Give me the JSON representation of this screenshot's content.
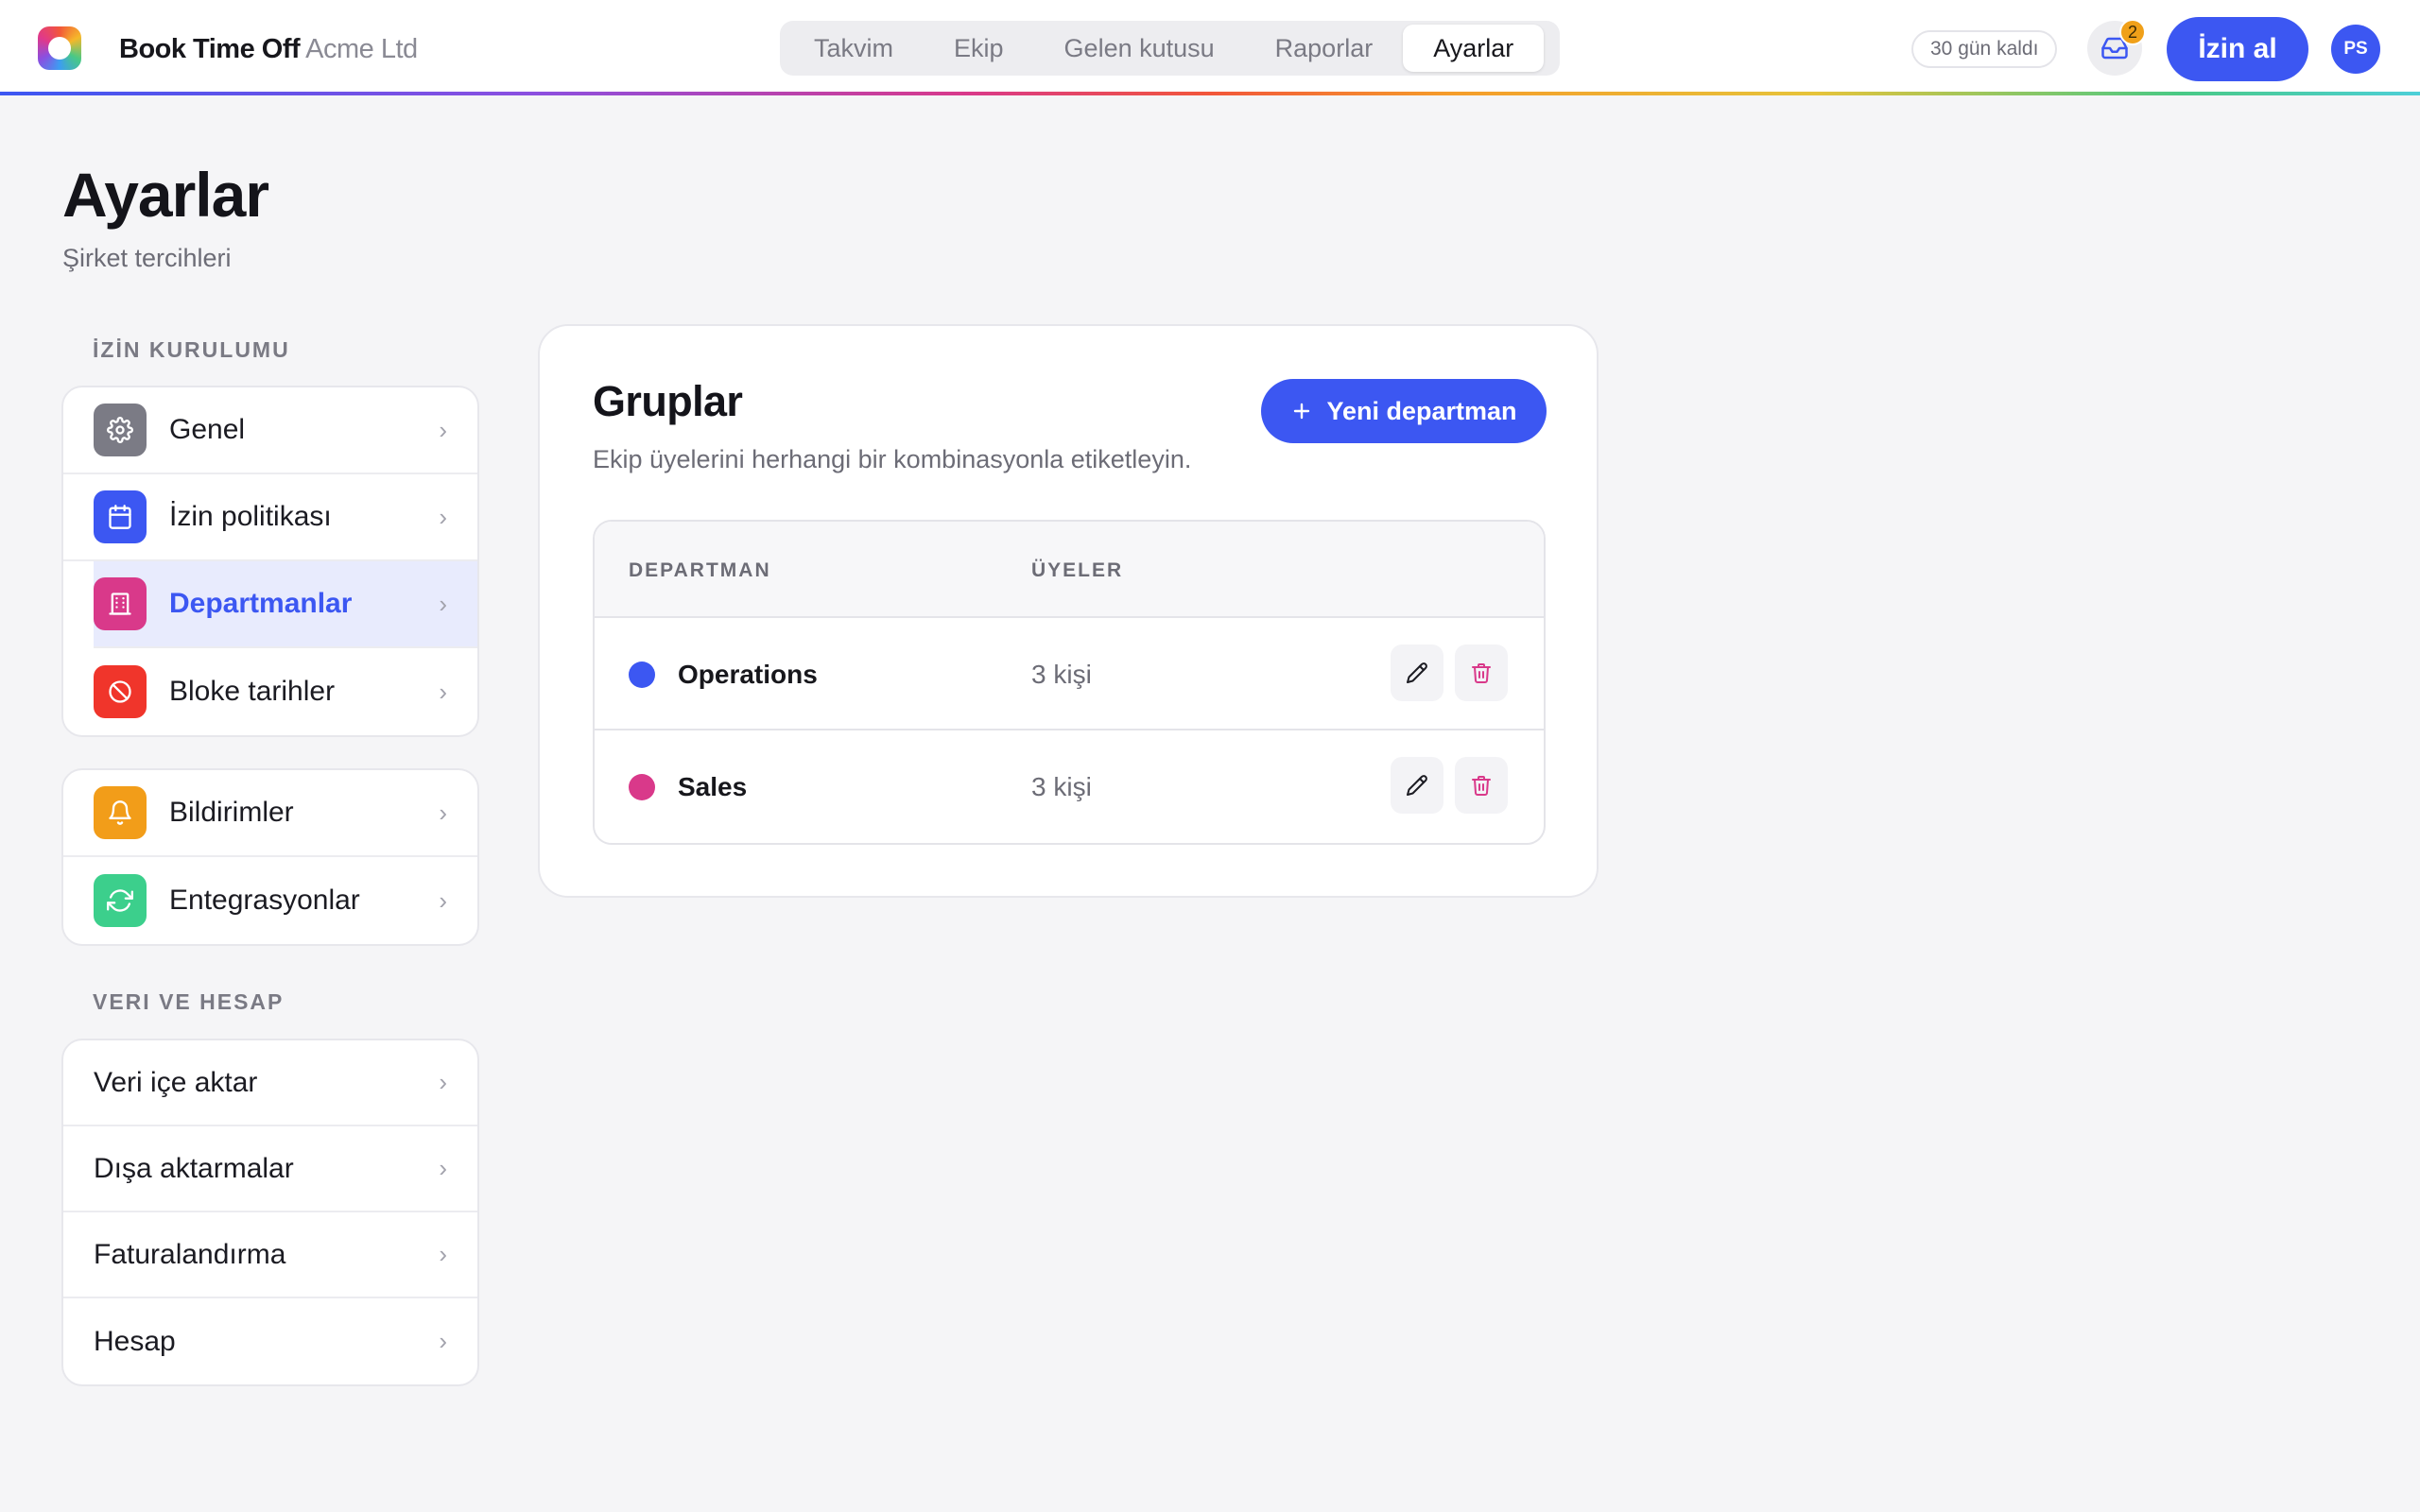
{
  "app": {
    "name": "Book Time Off",
    "org": "Acme Ltd"
  },
  "nav": {
    "tabs": [
      "Takvim",
      "Ekip",
      "Gelen kutusu",
      "Raporlar",
      "Ayarlar"
    ],
    "active_tab": "Ayarlar"
  },
  "header": {
    "trial": "30 gün kaldı",
    "inbox_count": "2",
    "primary_action": "İzin al",
    "avatar_initials": "PS"
  },
  "page": {
    "title": "Ayarlar",
    "subtitle": "Şirket tercihleri"
  },
  "sidebar": {
    "section1_label": "İZİN KURULUMU",
    "group1": [
      {
        "label": "Genel",
        "icon": "gear-icon",
        "color": "#7b7b85"
      },
      {
        "label": "İzin politikası",
        "icon": "calendar-icon",
        "color": "#3c57f2"
      },
      {
        "label": "Departmanlar",
        "icon": "building-icon",
        "color": "#d9398a",
        "active": true
      },
      {
        "label": "Bloke tarihler",
        "icon": "block-icon",
        "color": "#f0352b"
      }
    ],
    "group2": [
      {
        "label": "Bildirimler",
        "icon": "bell-icon",
        "color": "#f29d19"
      },
      {
        "label": "Entegrasyonlar",
        "icon": "sync-icon",
        "color": "#3ccf8c"
      }
    ],
    "section2_label": "VERI VE HESAP",
    "group3": [
      {
        "label": "Veri içe aktar"
      },
      {
        "label": "Dışa aktarmalar"
      },
      {
        "label": "Faturalandırma"
      },
      {
        "label": "Hesap"
      }
    ]
  },
  "main": {
    "title": "Gruplar",
    "subtitle": "Ekip üyelerini herhangi bir kombinasyonla etiketleyin.",
    "new_button": "Yeni departman",
    "columns": [
      "DEPARTMAN",
      "ÜYELER"
    ],
    "rows": [
      {
        "name": "Operations",
        "members": "3 kişi",
        "color": "#3c57f2"
      },
      {
        "name": "Sales",
        "members": "3 kişi",
        "color": "#d9398a"
      }
    ]
  }
}
